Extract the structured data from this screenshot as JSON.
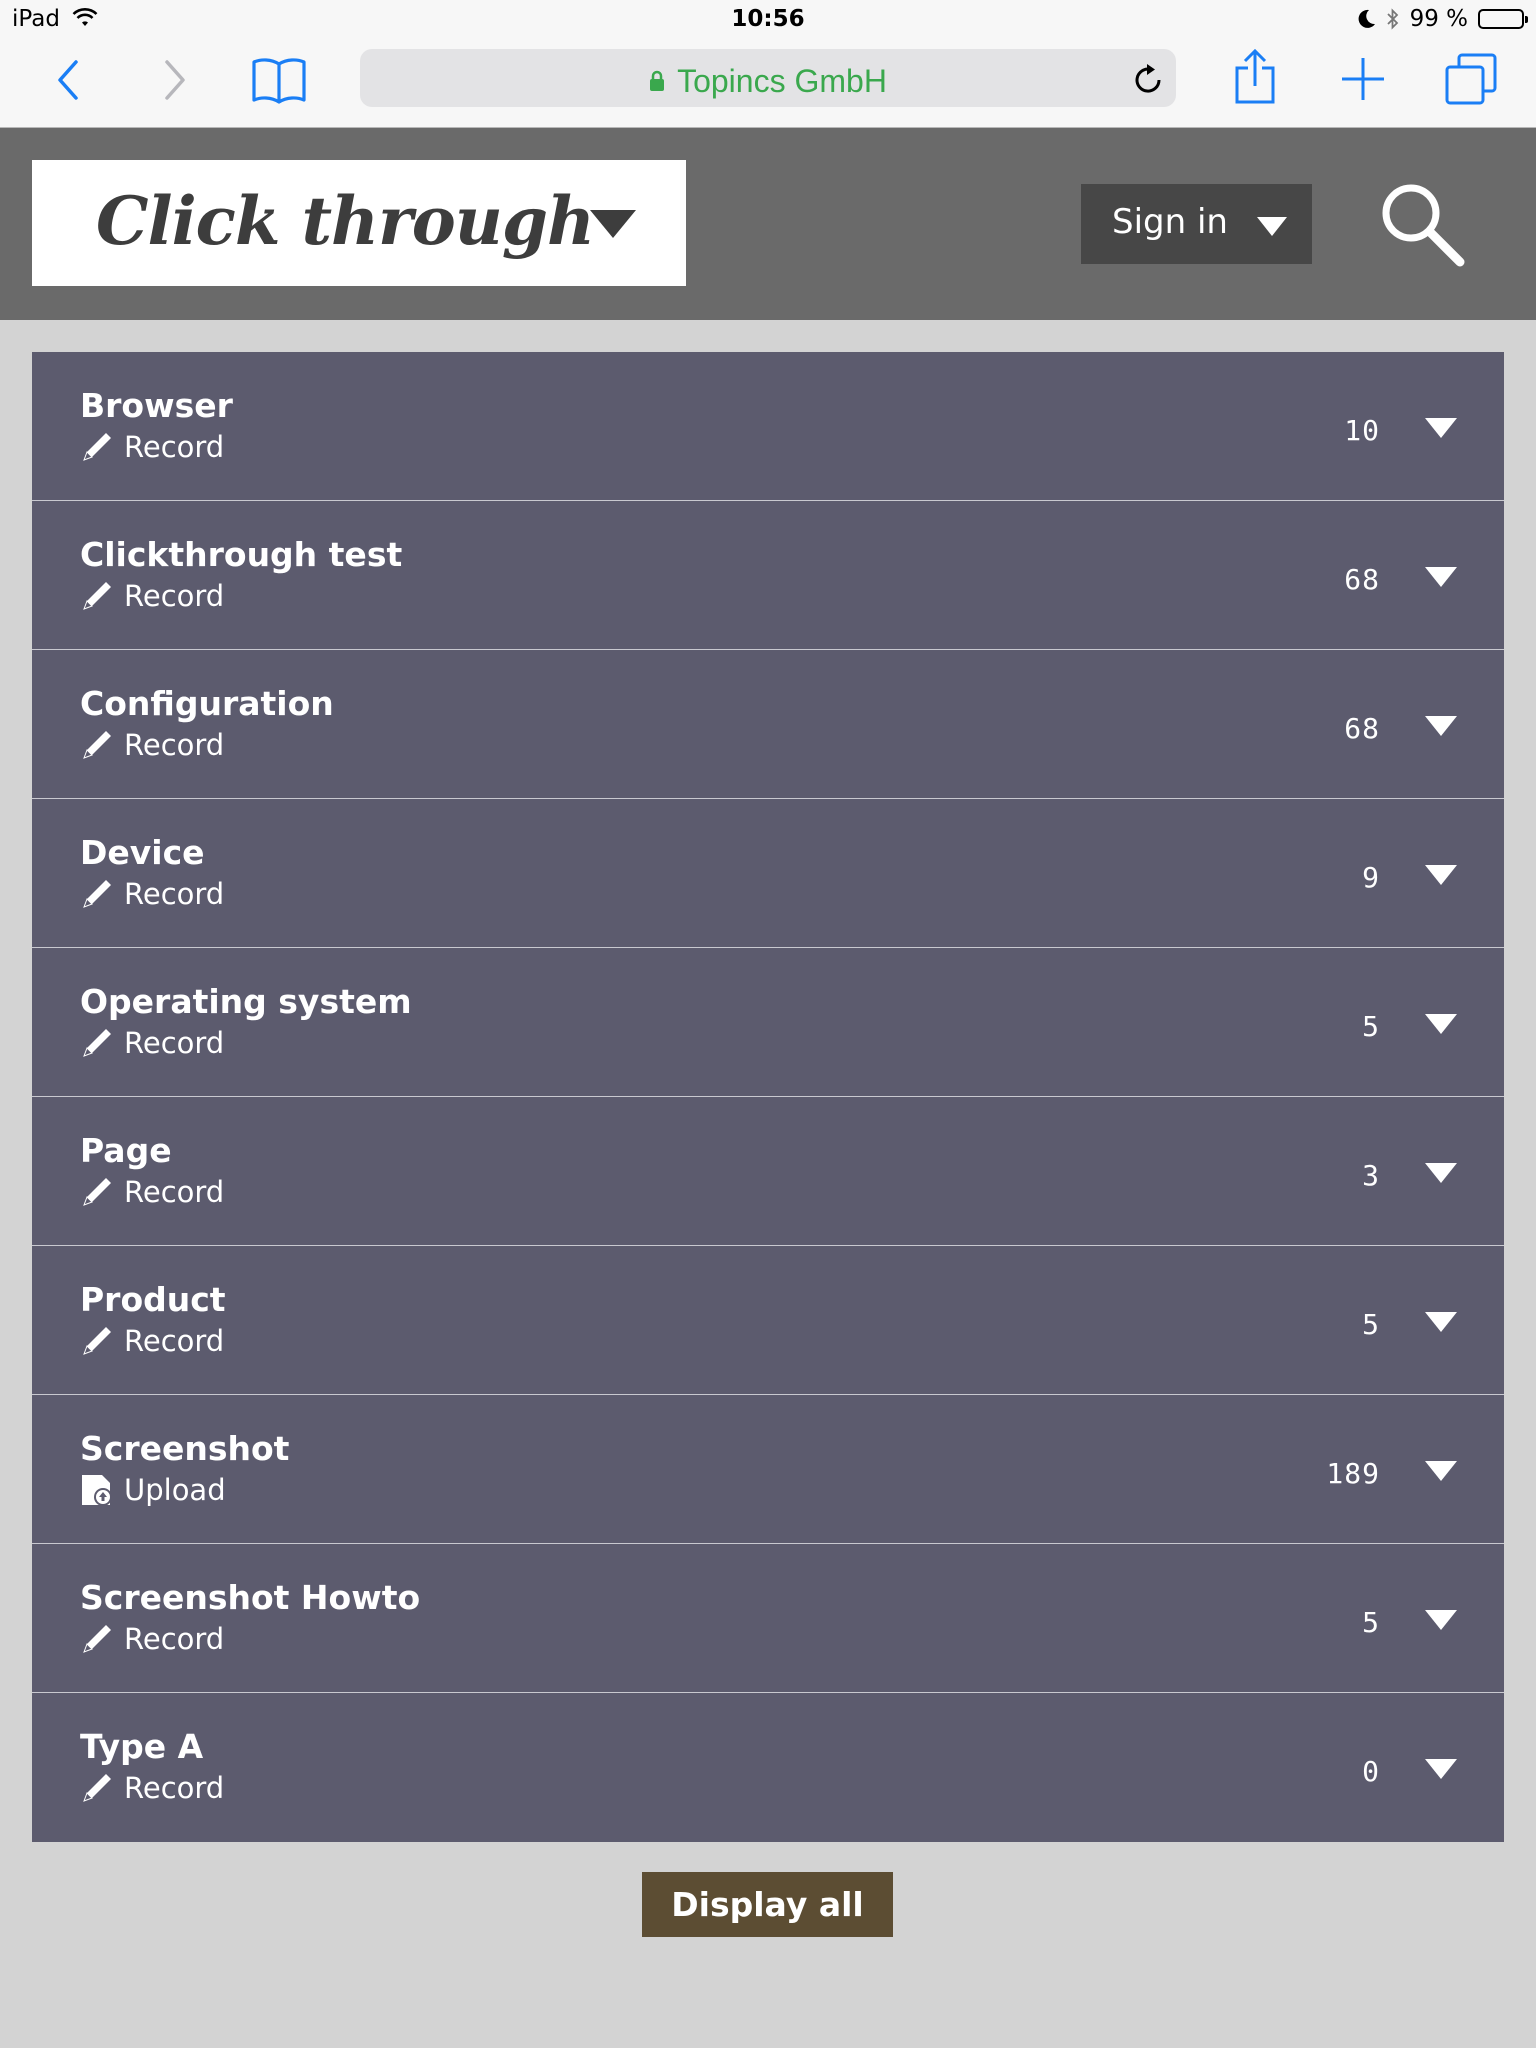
{
  "status_bar": {
    "device": "iPad",
    "time": "10:56",
    "battery": "99 %"
  },
  "browser": {
    "url_text": "Topincs GmbH"
  },
  "header": {
    "brand_title": "Click through",
    "sign_in_label": "Sign in"
  },
  "items": [
    {
      "title": "Browser",
      "action": "Record",
      "action_icon": "pencil-icon",
      "count": "10"
    },
    {
      "title": "Clickthrough test",
      "action": "Record",
      "action_icon": "pencil-icon",
      "count": "68"
    },
    {
      "title": "Configuration",
      "action": "Record",
      "action_icon": "pencil-icon",
      "count": "68"
    },
    {
      "title": "Device",
      "action": "Record",
      "action_icon": "pencil-icon",
      "count": "9"
    },
    {
      "title": "Operating system",
      "action": "Record",
      "action_icon": "pencil-icon",
      "count": "5"
    },
    {
      "title": "Page",
      "action": "Record",
      "action_icon": "pencil-icon",
      "count": "3"
    },
    {
      "title": "Product",
      "action": "Record",
      "action_icon": "pencil-icon",
      "count": "5"
    },
    {
      "title": "Screenshot",
      "action": "Upload",
      "action_icon": "upload-file-icon",
      "count": "189"
    },
    {
      "title": "Screenshot Howto",
      "action": "Record",
      "action_icon": "pencil-icon",
      "count": "5"
    },
    {
      "title": "Type A",
      "action": "Record",
      "action_icon": "pencil-icon",
      "count": "0"
    }
  ],
  "footer": {
    "display_all_label": "Display all"
  },
  "colors": {
    "list_bg": "#5c5b6e",
    "header_bg": "#6a6a6a",
    "page_bg": "#d3d3d3",
    "display_all_bg": "#5c4d33",
    "url_green": "#3aa84d",
    "ios_blue": "#1a7ef5"
  }
}
